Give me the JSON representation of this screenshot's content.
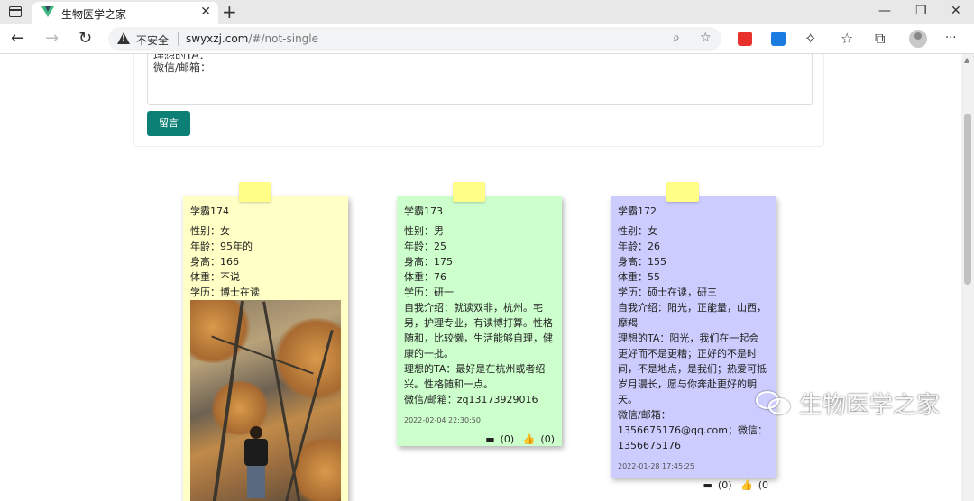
{
  "browser": {
    "tab_title": "生物医学之家",
    "new_tab": "+",
    "insecure_label": "不安全",
    "url_host": "swyxzj.com",
    "url_path": "/#/not-single",
    "minimize": "—",
    "restore": "❐",
    "close": "✕",
    "more": "···"
  },
  "form": {
    "textarea_lines": "理想的TA：\n微信/邮箱：",
    "submit_label": "留言"
  },
  "notes": [
    {
      "name": "学霸174",
      "gender": "性别：女",
      "age": "年龄：95年的",
      "height": "身高：166",
      "weight": "体重：不说",
      "education": "学历：博士在读"
    },
    {
      "name": "学霸173",
      "gender": "性别：男",
      "age": "年龄：25",
      "height": "身高：175",
      "weight": "体重：76",
      "education": "学历：研一",
      "intro": "自我介绍：就读双非，杭州。宅男，护理专业，有读博打算。性格随和，比较懒，生活能够自理，健康的一批。",
      "ideal": "理想的TA：最好是在杭州或者绍兴。性格随和一点。",
      "contact": "微信/邮箱：zq13173929016",
      "date": "2022-02-04 22:30:50",
      "comments": "(0)",
      "likes": "(0)"
    },
    {
      "name": "学霸172",
      "gender": "性别：女",
      "age": "年龄：26",
      "height": "身高：155",
      "weight": "体重：55",
      "education": "学历：硕士在读，研三",
      "intro": "自我介绍：阳光，正能量，山西，摩羯",
      "ideal": "理想的TA：阳光，我们在一起会更好而不是更糟；正好的不是时间，不是地点，是我们；热爱可抵岁月漫长，愿与你奔赴更好的明天。",
      "contact": "微信/邮箱：1356675176@qq.com；微信：1356675176",
      "date": "2022-01-28 17:45:25",
      "comments": "(0)",
      "likes": "(0"
    }
  ],
  "watermark": "生物医学之家"
}
